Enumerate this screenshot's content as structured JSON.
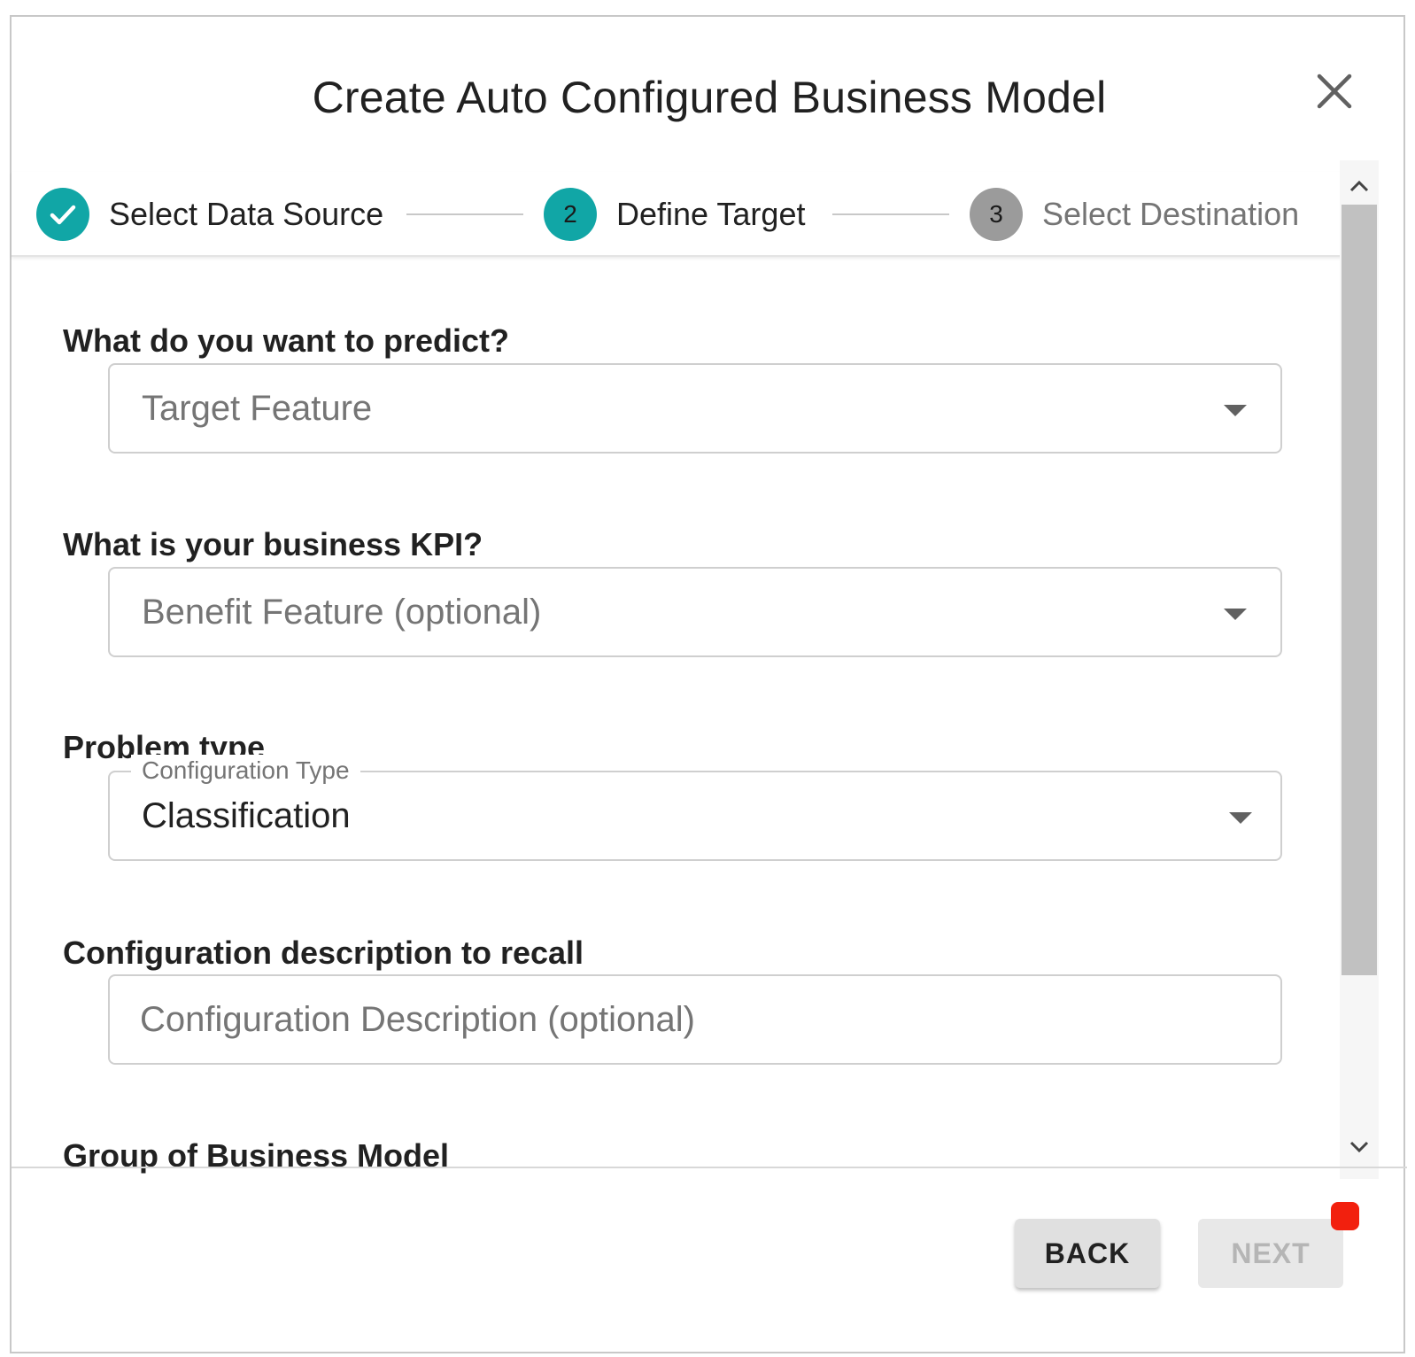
{
  "dialog": {
    "title": "Create Auto Configured Business Model",
    "close_icon": "close-icon"
  },
  "stepper": {
    "steps": [
      {
        "number": "1",
        "label": "Select Data Source",
        "state": "completed",
        "icon": "check-icon"
      },
      {
        "number": "2",
        "label": "Define Target",
        "state": "active"
      },
      {
        "number": "3",
        "label": "Select Destination",
        "state": "pending"
      }
    ]
  },
  "form": {
    "predict": {
      "label": "What do you want to predict?",
      "placeholder": "Target Feature"
    },
    "kpi": {
      "label": "What is your business KPI?",
      "placeholder": "Benefit Feature (optional)"
    },
    "problem_type": {
      "label": "Problem type",
      "field_label": "Configuration Type",
      "value": "Classification"
    },
    "description": {
      "label": "Configuration description to recall",
      "placeholder": "Configuration Description (optional)",
      "value": ""
    },
    "group": {
      "label": "Group of Business Model"
    }
  },
  "footer": {
    "back_label": "BACK",
    "next_label": "NEXT"
  },
  "colors": {
    "accent": "#11a6a6",
    "pending": "#9b9b9b",
    "badge": "#f2200e"
  }
}
